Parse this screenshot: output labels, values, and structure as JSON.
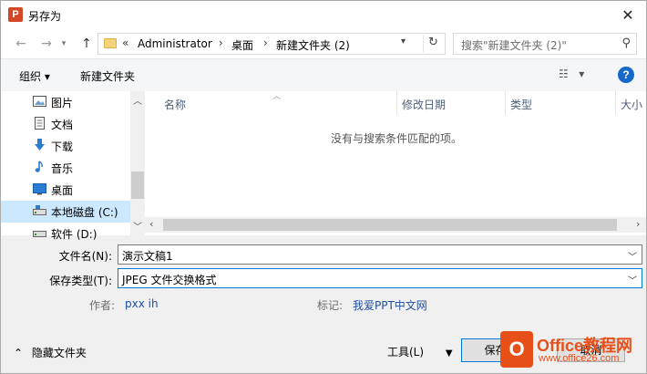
{
  "window": {
    "title": "另存为",
    "app_icon": "P"
  },
  "nav": {
    "address": {
      "root": "Administrator",
      "crumbs": [
        "桌面",
        "新建文件夹 (2)"
      ]
    },
    "search_placeholder": "搜索\"新建文件夹 (2)\""
  },
  "toolbar": {
    "organize": "组织 ▾",
    "new_folder": "新建文件夹",
    "help": "?"
  },
  "sidebar": {
    "items": [
      {
        "label": "图片",
        "icon": "pictures-icon"
      },
      {
        "label": "文档",
        "icon": "documents-icon"
      },
      {
        "label": "下载",
        "icon": "downloads-icon"
      },
      {
        "label": "音乐",
        "icon": "music-icon"
      },
      {
        "label": "桌面",
        "icon": "desktop-icon"
      },
      {
        "label": "本地磁盘 (C:)",
        "icon": "drive-icon",
        "selected": true
      },
      {
        "label": "软件 (D:)",
        "icon": "drive-icon"
      }
    ]
  },
  "filelist": {
    "columns": [
      "名称",
      "修改日期",
      "类型",
      "大小"
    ],
    "empty_text": "没有与搜索条件匹配的项。"
  },
  "form": {
    "filename_label": "文件名(N):",
    "filename_value": "演示文稿1",
    "filetype_label": "保存类型(T):",
    "filetype_value": "JPEG 文件交换格式",
    "author_label": "作者:",
    "author_value": "pxx ih",
    "tags_label": "标记:",
    "tags_value": "我爱PPT中文网"
  },
  "footer": {
    "hide_folders": "隐藏文件夹",
    "tools": "工具(L)",
    "save": "保存",
    "cancel": "取消"
  },
  "watermark": {
    "brand": "Office教程网",
    "url": "www.office26.com"
  }
}
